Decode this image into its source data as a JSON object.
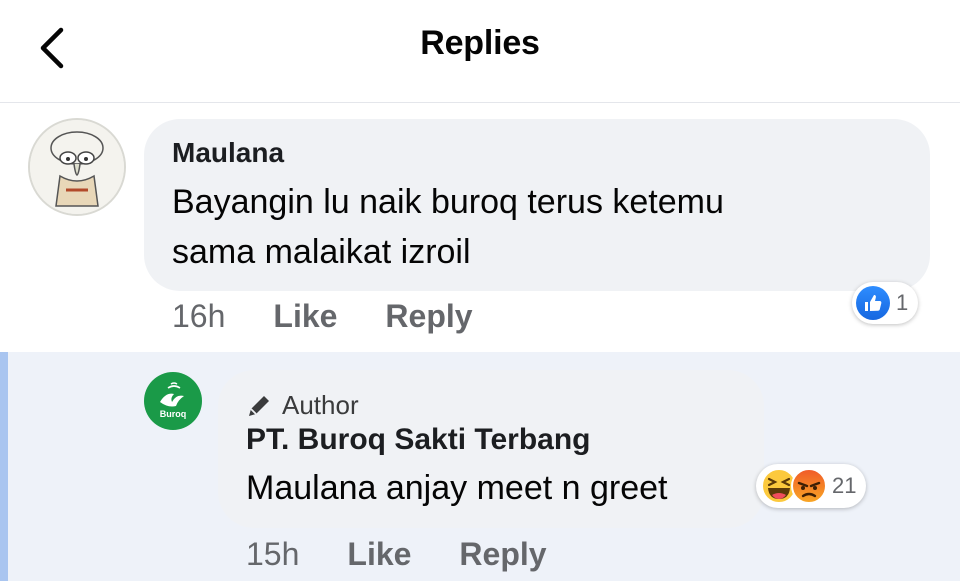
{
  "header": {
    "title": "Replies"
  },
  "comment": {
    "author": "Maulana",
    "text_line1": "Bayangin lu naik buroq terus ketemu",
    "text_line2": "sama malaikat izroil",
    "time": "16h",
    "like_label": "Like",
    "reply_label": "Reply",
    "reaction_count": "1",
    "reaction_icons": [
      "like-icon"
    ]
  },
  "reply": {
    "badge": "Author",
    "author": "PT. Buroq Sakti Terbang",
    "avatar_text": "Buroq",
    "text": "Maulana anjay meet n greet",
    "time": "15h",
    "like_label": "Like",
    "reply_label": "Reply",
    "reaction_count": "21",
    "reaction_icons": [
      "haha-icon",
      "angry-icon"
    ]
  },
  "colors": {
    "bubble": "#f0f2f5",
    "reply_background": "#eef2f9",
    "reply_bar": "#a9c5f0",
    "like_blue": "#1877f2",
    "secondary_text": "#65676b"
  }
}
